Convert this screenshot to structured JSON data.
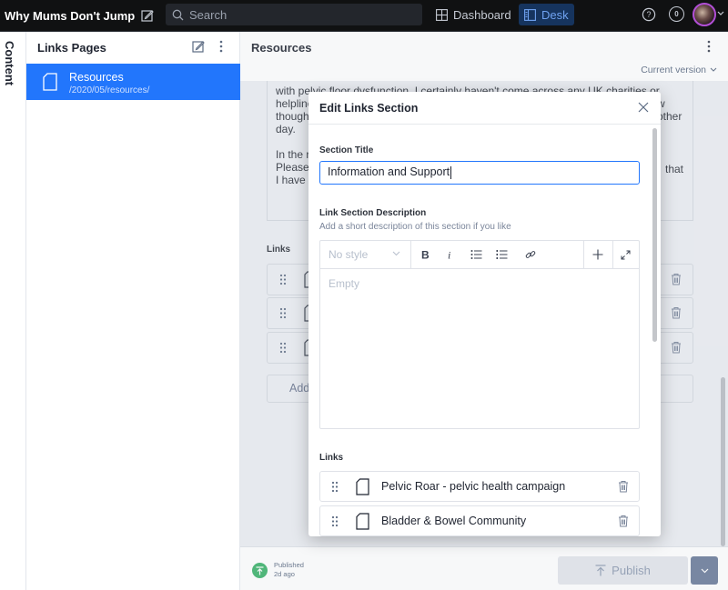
{
  "topbar": {
    "brand": "Why Mums Don't Jump",
    "search_placeholder": "Search",
    "nav": [
      {
        "label": "Dashboard",
        "active": false
      },
      {
        "label": "Desk",
        "active": true
      }
    ],
    "notification_count": "0"
  },
  "content_tab": {
    "label": "Content"
  },
  "pane_list": {
    "title": "Links Pages",
    "items": [
      {
        "title": "Resources",
        "subtitle": "/2020/05/resources/",
        "selected": true
      }
    ]
  },
  "document": {
    "title": "Resources",
    "version_label": "Current version",
    "body_lines": [
      "with pelvic floor dysfunction. I certainly haven't come across any UK charities or",
      "helpline",
      "though",
      "day."
    ],
    "body_right_fragments": [
      "w",
      "other"
    ],
    "body_para2_lines": [
      "In the r",
      "Please",
      "I have r"
    ],
    "body_para2_right": [
      "that"
    ],
    "links_label": "Links",
    "link_rows": 3,
    "add_label": "Add"
  },
  "footer": {
    "status_label": "Published",
    "status_time": "2d ago",
    "publish_label": "Publish"
  },
  "modal": {
    "title": "Edit Links Section",
    "section_title_label": "Section Title",
    "section_title_value": "Information and Support",
    "description_label": "Link Section Description",
    "description_help": "Add a short description of this section if you like",
    "editor": {
      "style_select": "No style",
      "placeholder": "Empty",
      "tools": [
        "bold",
        "italic",
        "bullet-list",
        "numbered-list",
        "link",
        "insert",
        "expand"
      ]
    },
    "links_label": "Links",
    "links": [
      {
        "title": "Pelvic Roar - pelvic health campaign"
      },
      {
        "title": "Bladder & Bowel Community"
      }
    ]
  }
}
